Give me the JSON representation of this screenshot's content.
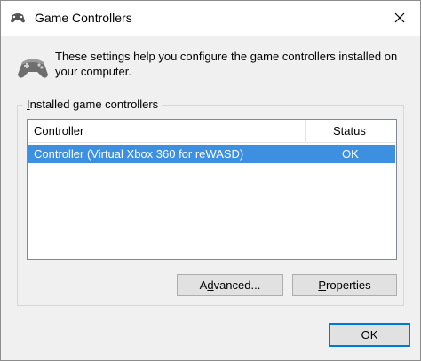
{
  "window": {
    "title": "Game Controllers",
    "close_glyph": "✕"
  },
  "intro": {
    "line1": "These settings help you configure the game controllers installed on",
    "line2": "your computer."
  },
  "group": {
    "legend_first": "I",
    "legend_rest": "nstalled game controllers"
  },
  "list": {
    "columns": [
      "Controller",
      "Status"
    ],
    "rows": [
      {
        "controller": "Controller (Virtual Xbox 360 for reWASD)",
        "status": "OK",
        "selected": true
      }
    ]
  },
  "buttons": {
    "advanced_pre": "A",
    "advanced_ul": "d",
    "advanced_post": "vanced...",
    "properties_ul": "P",
    "properties_post": "roperties",
    "ok": "OK"
  },
  "colors": {
    "selection": "#3d8fe0",
    "focus_border": "#0078d7",
    "button_face": "#e1e1e1"
  },
  "icons": {
    "title": "gamepad-icon",
    "intro": "gamepad-icon"
  }
}
